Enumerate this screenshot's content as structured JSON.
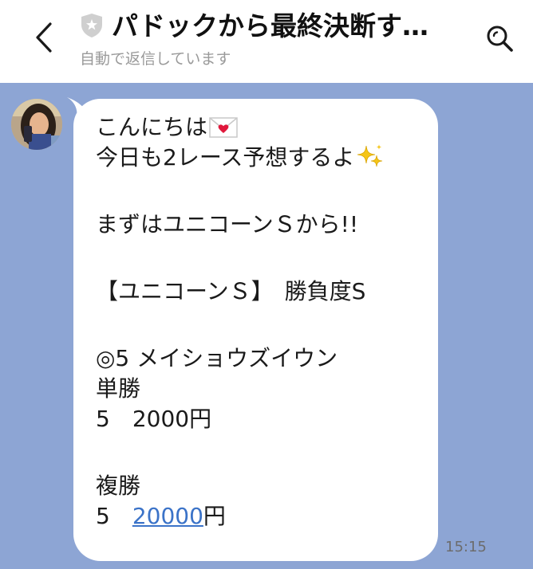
{
  "header": {
    "title": "パドックから最終決断す…",
    "subtitle": "自動で返信しています",
    "back_icon": "chevron-left-icon",
    "search_icon": "search-icon",
    "shield_icon": "shield-icon",
    "shield_color": "#cfcfcf"
  },
  "message": {
    "line1": "こんにちは",
    "line2": "今日も2レース予想するよ",
    "line3": "まずはユニコーンＳから!!",
    "line4": "【ユニコーンＳ】　勝負度S",
    "line5": "◎5 メイショウズイウン",
    "line6": "単勝",
    "line7": "5　2000円",
    "line8": "複勝",
    "line9_prefix": "5　",
    "line9_link": "20000",
    "line9_suffix": "円",
    "love_letter_icon": "love-letter-icon",
    "sparkles_icon": "sparkles-icon",
    "link_color": "#3b73c8"
  },
  "time": "15:15",
  "background_color": "#8da5d4"
}
